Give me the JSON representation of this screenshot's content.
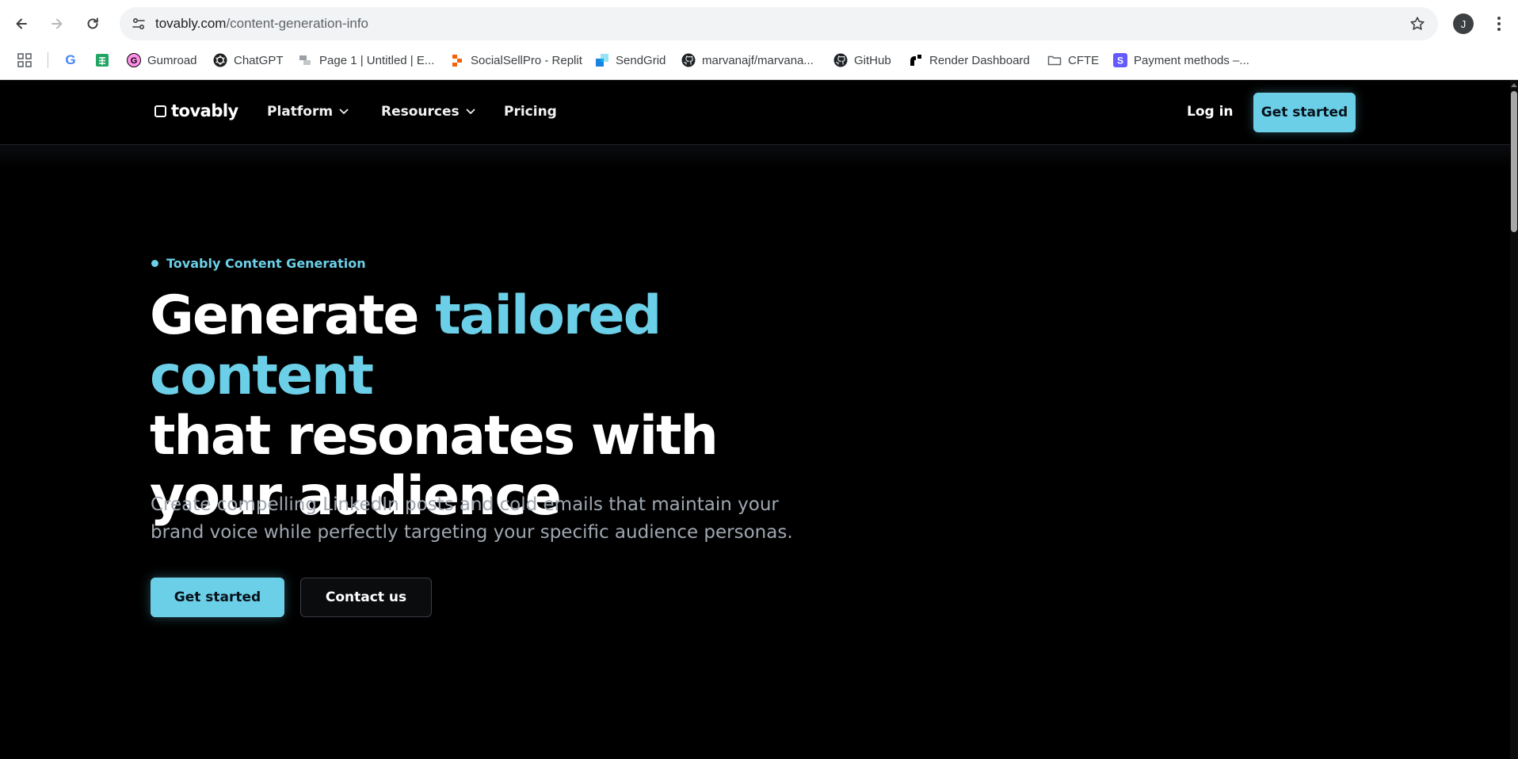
{
  "browser": {
    "url_host": "tovably.com",
    "url_path": "/content-generation-info",
    "profile_initial": "J",
    "bookmarks": [
      {
        "label": "",
        "icon": "google-icon"
      },
      {
        "label": "",
        "icon": "sheets-icon"
      },
      {
        "label": "Gumroad",
        "icon": "gumroad-icon"
      },
      {
        "label": "ChatGPT",
        "icon": "chatgpt-icon"
      },
      {
        "label": "Page 1 | Untitled | E...",
        "icon": "page-icon"
      },
      {
        "label": "SocialSellPro - Replit",
        "icon": "replit-icon"
      },
      {
        "label": "SendGrid",
        "icon": "sendgrid-icon"
      },
      {
        "label": "marvanajf/marvana...",
        "icon": "github-icon"
      },
      {
        "label": "GitHub",
        "icon": "github-icon"
      },
      {
        "label": "Render Dashboard",
        "icon": "render-icon"
      },
      {
        "label": "CFTE",
        "icon": "folder-icon"
      },
      {
        "label": "Payment methods –...",
        "icon": "stripe-icon"
      }
    ]
  },
  "header": {
    "logo_text": "tovably",
    "nav": {
      "platform": "Platform",
      "resources": "Resources",
      "pricing": "Pricing"
    },
    "login": "Log in",
    "cta": "Get started"
  },
  "hero": {
    "eyebrow": "Tovably Content Generation",
    "headline_lead": "Generate ",
    "headline_accent": "tailored content",
    "headline_rest": "that resonates with your audience",
    "subtext": "Create compelling LinkedIn posts and cold emails that maintain your brand voice while perfectly targeting your specific audience personas.",
    "primary_cta": "Get started",
    "secondary_cta": "Contact us"
  },
  "colors": {
    "accent": "#6ccfe8",
    "background": "#000000",
    "body_text": "#a0a7b1"
  }
}
